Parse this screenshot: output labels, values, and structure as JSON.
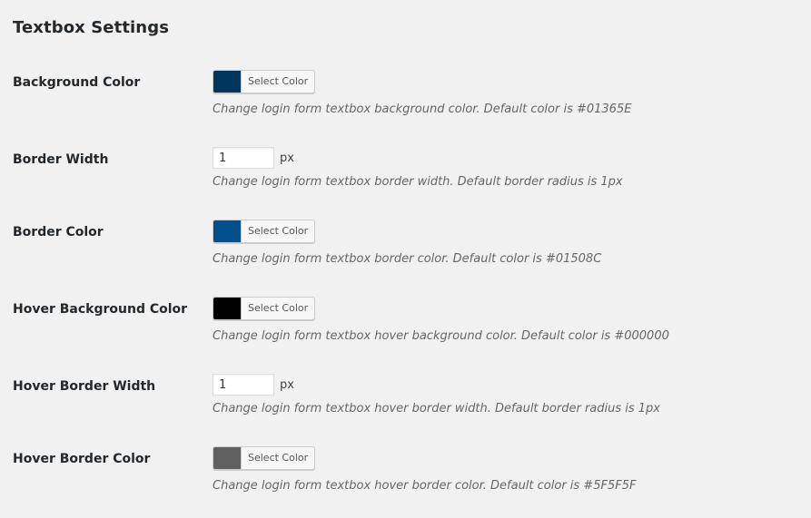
{
  "section": {
    "title": "Textbox Settings"
  },
  "rows": [
    {
      "label": "Background Color",
      "type": "color",
      "swatch_color": "#01365E",
      "button_label": "Select Color",
      "description": "Change login form textbox background color. Default color is #01365E"
    },
    {
      "label": "Border Width",
      "type": "number",
      "value": "1",
      "unit": "px",
      "description": "Change login form textbox border width. Default border radius is 1px"
    },
    {
      "label": "Border Color",
      "type": "color",
      "swatch_color": "#01508C",
      "button_label": "Select Color",
      "description": "Change login form textbox border color. Default color is #01508C"
    },
    {
      "label": "Hover Background Color",
      "type": "color",
      "swatch_color": "#000000",
      "button_label": "Select Color",
      "description": "Change login form textbox hover background color. Default color is #000000"
    },
    {
      "label": "Hover Border Width",
      "type": "number",
      "value": "1",
      "unit": "px",
      "description": "Change login form textbox hover border width. Default border radius is 1px"
    },
    {
      "label": "Hover Border Color",
      "type": "color",
      "swatch_color": "#5F5F5F",
      "button_label": "Select Color",
      "description": "Change login form textbox hover border color. Default color is #5F5F5F"
    }
  ]
}
